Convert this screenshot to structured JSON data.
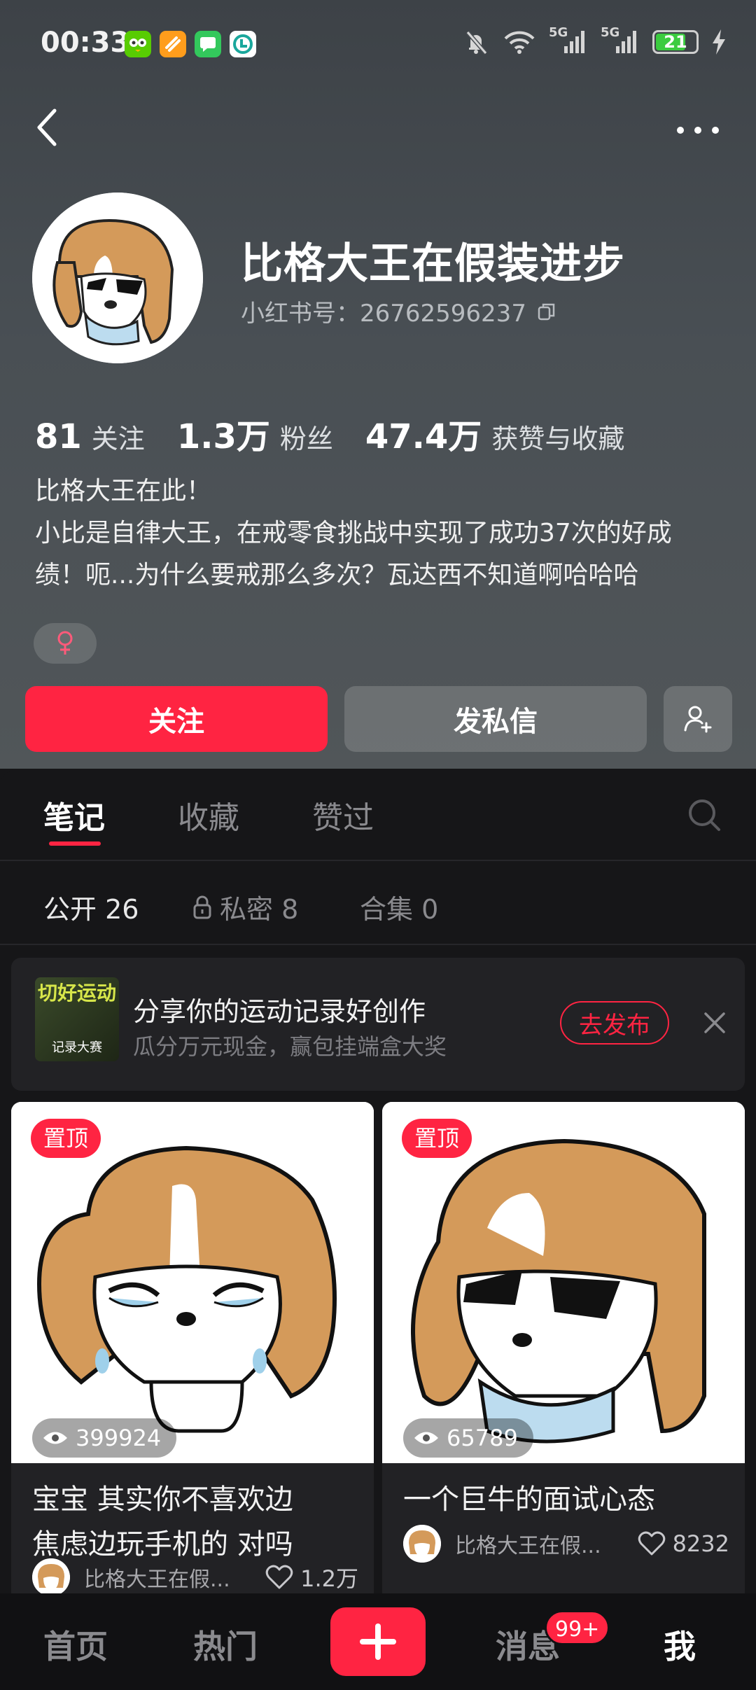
{
  "status_bar": {
    "time": "00:33",
    "network_1": "5G",
    "network_2": "5G",
    "battery_level": 21,
    "battery_text": "21"
  },
  "profile": {
    "name": "比格大王在假装进步",
    "id_label": "小红书号：",
    "id_value": "26762596237",
    "stats": [
      {
        "num": "81",
        "label": "关注"
      },
      {
        "num": "1.3万",
        "label": "粉丝"
      },
      {
        "num": "47.4万",
        "label": "获赞与收藏"
      }
    ],
    "bio_lines": [
      "比格大王在此！",
      "小比是自律大王，在戒零食挑战中实现了成功37次的好成",
      "绩！呃...为什么要戒那么多次？瓦达西不知道啊哈哈哈"
    ],
    "gender_icon": "female-icon"
  },
  "actions": {
    "follow": "关注",
    "message": "发私信"
  },
  "tabs": [
    "笔记",
    "收藏",
    "赞过"
  ],
  "subtabs": {
    "public": "公开 26",
    "private": "私密 8",
    "collections": "合集 0"
  },
  "banner": {
    "thumb_title": "切好运动",
    "thumb_sub": "记录大赛",
    "title": "分享你的运动记录好创作",
    "subtitle": "瓜分万元现金，赢包挂端盒大奖",
    "button": "去发布"
  },
  "notes": [
    {
      "pin": "置顶",
      "views": "399924",
      "title_lines": [
        "宝宝 其实你不喜欢边",
        "焦虑边玩手机的 对吗"
      ],
      "author": "比格大王在假...",
      "likes": "1.2万"
    },
    {
      "pin": "置顶",
      "views": "65789",
      "title_lines": [
        "一个巨牛的面试心态"
      ],
      "author": "比格大王在假...",
      "likes": "8232"
    }
  ],
  "bottom_nav": {
    "home": "首页",
    "hot": "热门",
    "messages": "消息",
    "messages_badge": "99+",
    "me": "我"
  },
  "colors": {
    "accent": "#ff2442",
    "background": "#161618"
  }
}
